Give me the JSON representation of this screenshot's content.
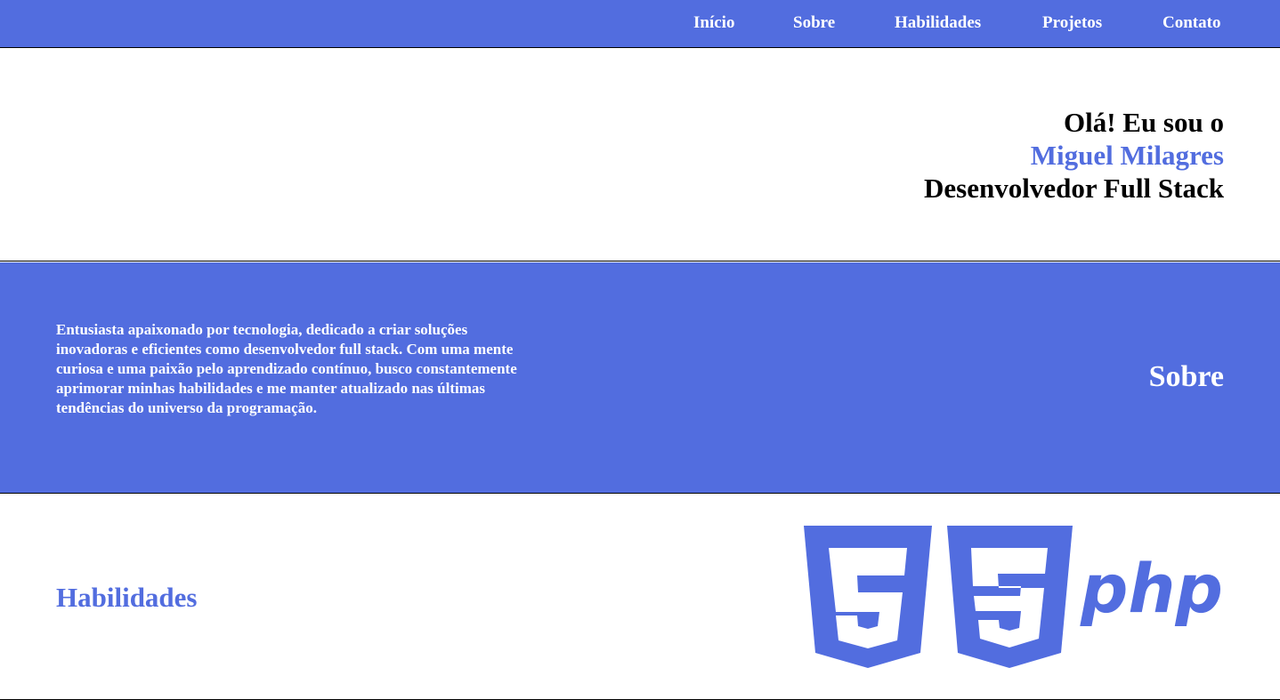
{
  "nav": {
    "items": [
      {
        "label": "Início"
      },
      {
        "label": "Sobre"
      },
      {
        "label": "Habilidades"
      },
      {
        "label": "Projetos"
      },
      {
        "label": "Contato"
      }
    ]
  },
  "hero": {
    "greeting": "Olá! Eu sou o",
    "name": "Miguel Milagres",
    "role": "Desenvolvedor Full Stack"
  },
  "about": {
    "title": "Sobre",
    "text": "Entusiasta apaixonado por tecnologia, dedicado a criar soluções inovadoras e eficientes como desenvolvedor full stack. Com uma mente curiosa e uma paixão pelo aprendizado contínuo, busco constantemente aprimorar minhas habilidades e me manter atualizado nas últimas tendências do universo da programação."
  },
  "skills": {
    "title": "Habilidades",
    "icons": [
      "html5-icon",
      "css3-icon",
      "php-icon"
    ],
    "php_label": "php"
  },
  "colors": {
    "accent": "#526ddf",
    "background": "#ffffff",
    "text": "#000000"
  }
}
